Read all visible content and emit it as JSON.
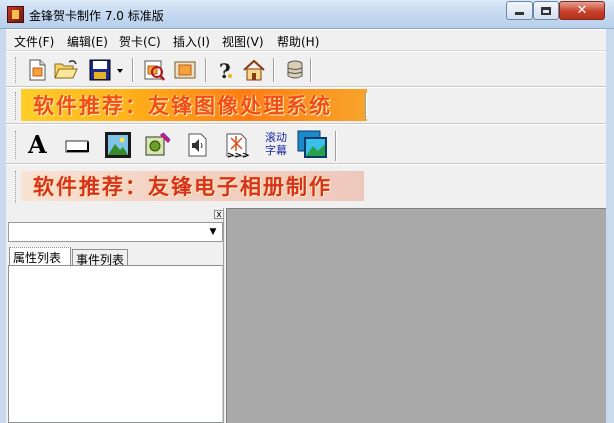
{
  "window": {
    "title": "金锋贺卡制作 7.0 标准版",
    "app_icon": "card-app-icon",
    "buttons": {
      "minimize": "minimize-icon",
      "maximize": "maximize-icon",
      "close": "close-icon"
    },
    "close_glyph": "✕"
  },
  "menu": {
    "items": [
      "文件(F)",
      "编辑(E)",
      "贺卡(C)",
      "插入(I)",
      "视图(V)",
      "帮助(H)"
    ]
  },
  "toolbar1": {
    "buttons": [
      "new-card-icon",
      "open-folder-icon",
      "save-disk-icon",
      "save-dropdown-icon",
      "search-card-icon",
      "preview-card-icon",
      "help-icon",
      "home-icon",
      "database-icon"
    ]
  },
  "banners": {
    "banner_top": "软件推荐：友锋图像处理系统",
    "banner_bottom": "软件推荐：友锋电子相册制作"
  },
  "toolbar2": {
    "text_tool": "A",
    "scroll_text_label_line1": "滚动",
    "scroll_text_label_line2": "字幕",
    "buttons": [
      "text-tool-icon",
      "rectangle-tool-icon",
      "image-tool-icon",
      "effect-tool-icon",
      "sound-tool-icon",
      "animation-tool-icon",
      "scroll-text-icon",
      "background-tool-icon"
    ]
  },
  "left_panel": {
    "close_glyph": "x",
    "combo_value": "",
    "combo_arrow": "▼",
    "tabs": [
      "属性列表",
      "事件列表"
    ],
    "active_tab": "属性列表"
  },
  "colors": {
    "workspace": "#a9a9a9",
    "banner_top_gradient": [
      "#ffce28",
      "#ff7d14"
    ],
    "banner_text": "#f14e17"
  }
}
